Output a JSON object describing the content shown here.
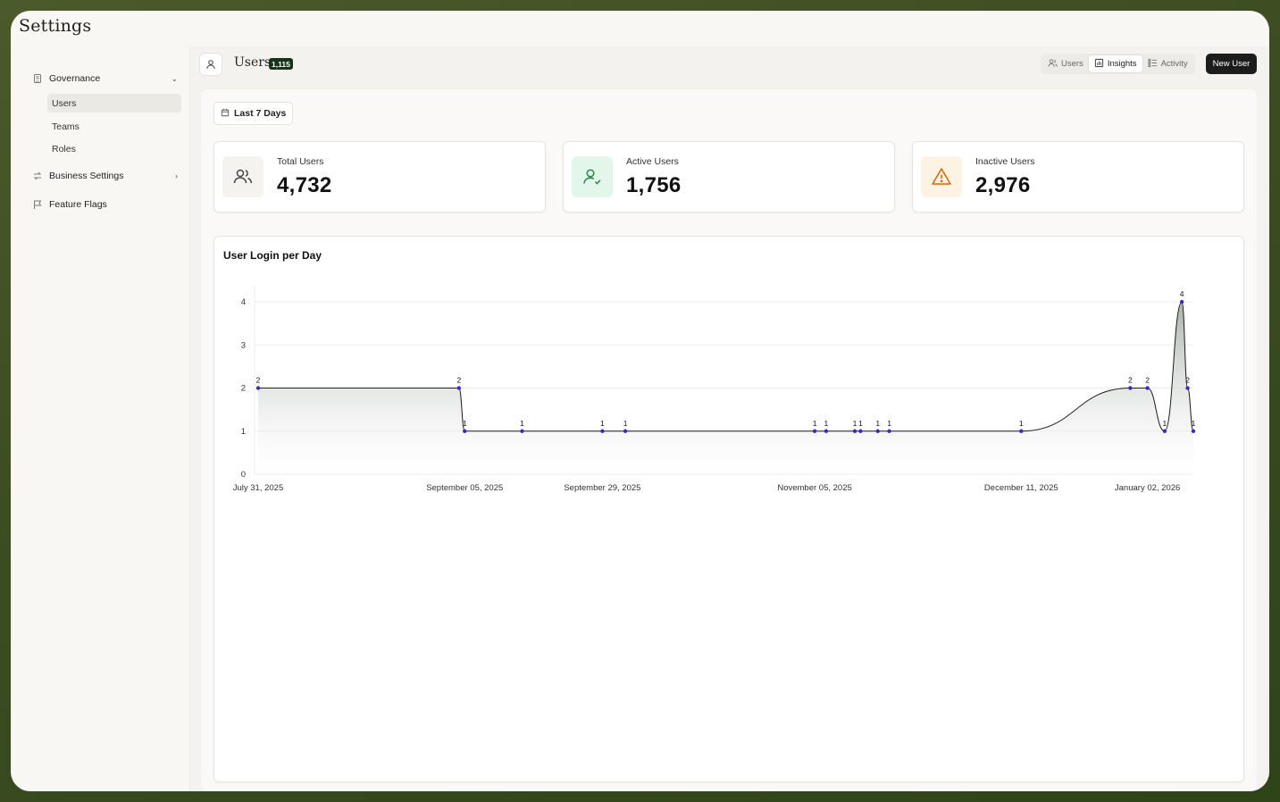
{
  "app": {
    "title": "Settings"
  },
  "sidebar": {
    "governance": {
      "label": "Governance",
      "icon": "building-icon"
    },
    "sub_items": [
      {
        "label": "Users",
        "active": true
      },
      {
        "label": "Teams",
        "active": false
      },
      {
        "label": "Roles",
        "active": false
      }
    ],
    "business_settings": {
      "label": "Business Settings",
      "icon": "swap-arrows-icon"
    },
    "feature_flags": {
      "label": "Feature Flags",
      "icon": "flag-icon"
    }
  },
  "header": {
    "title": "Users",
    "count_badge": "1,115",
    "tabs": [
      {
        "label": "Users",
        "icon": "users-icon",
        "active": false
      },
      {
        "label": "Insights",
        "icon": "chart-icon",
        "active": true
      },
      {
        "label": "Activity",
        "icon": "list-icon",
        "active": false
      }
    ],
    "new_user_label": "New User"
  },
  "filter": {
    "date_range": "Last 7 Days"
  },
  "stats": [
    {
      "label": "Total Users",
      "value": "4,732",
      "icon": "users-icon",
      "icon_bg": "#f5f3ef",
      "icon_color": "#444444"
    },
    {
      "label": "Active Users",
      "value": "1,756",
      "icon": "user-check-icon",
      "icon_bg": "#e3f6ea",
      "icon_color": "#1f8a4c"
    },
    {
      "label": "Inactive Users",
      "value": "2,976",
      "icon": "warning-icon",
      "icon_bg": "#fdf3e3",
      "icon_color": "#d9620b"
    }
  ],
  "chart_data": {
    "type": "area",
    "title": "User Login per Day",
    "xlabel": "",
    "ylabel": "",
    "ylim": [
      0,
      4
    ],
    "yticks": [
      0,
      1,
      2,
      3,
      4
    ],
    "xticks": [
      "July 31, 2025",
      "September 05, 2025",
      "September 29, 2025",
      "November 05, 2025",
      "December 11, 2025",
      "January 02, 2026"
    ],
    "x": [
      "2025-07-31",
      "2025-09-04",
      "2025-09-05",
      "2025-09-15",
      "2025-09-29",
      "2025-10-03",
      "2025-11-05",
      "2025-11-07",
      "2025-11-12",
      "2025-11-13",
      "2025-11-16",
      "2025-11-18",
      "2025-12-11",
      "2025-12-30",
      "2026-01-02",
      "2026-01-05",
      "2026-01-08",
      "2026-01-09",
      "2026-01-10"
    ],
    "values": [
      2,
      2,
      1,
      1,
      1,
      1,
      1,
      1,
      1,
      1,
      1,
      1,
      1,
      2,
      2,
      1,
      4,
      2,
      1
    ],
    "grid": true,
    "point_color": "#3b2ab8",
    "line_color": "#1c1c1c"
  }
}
